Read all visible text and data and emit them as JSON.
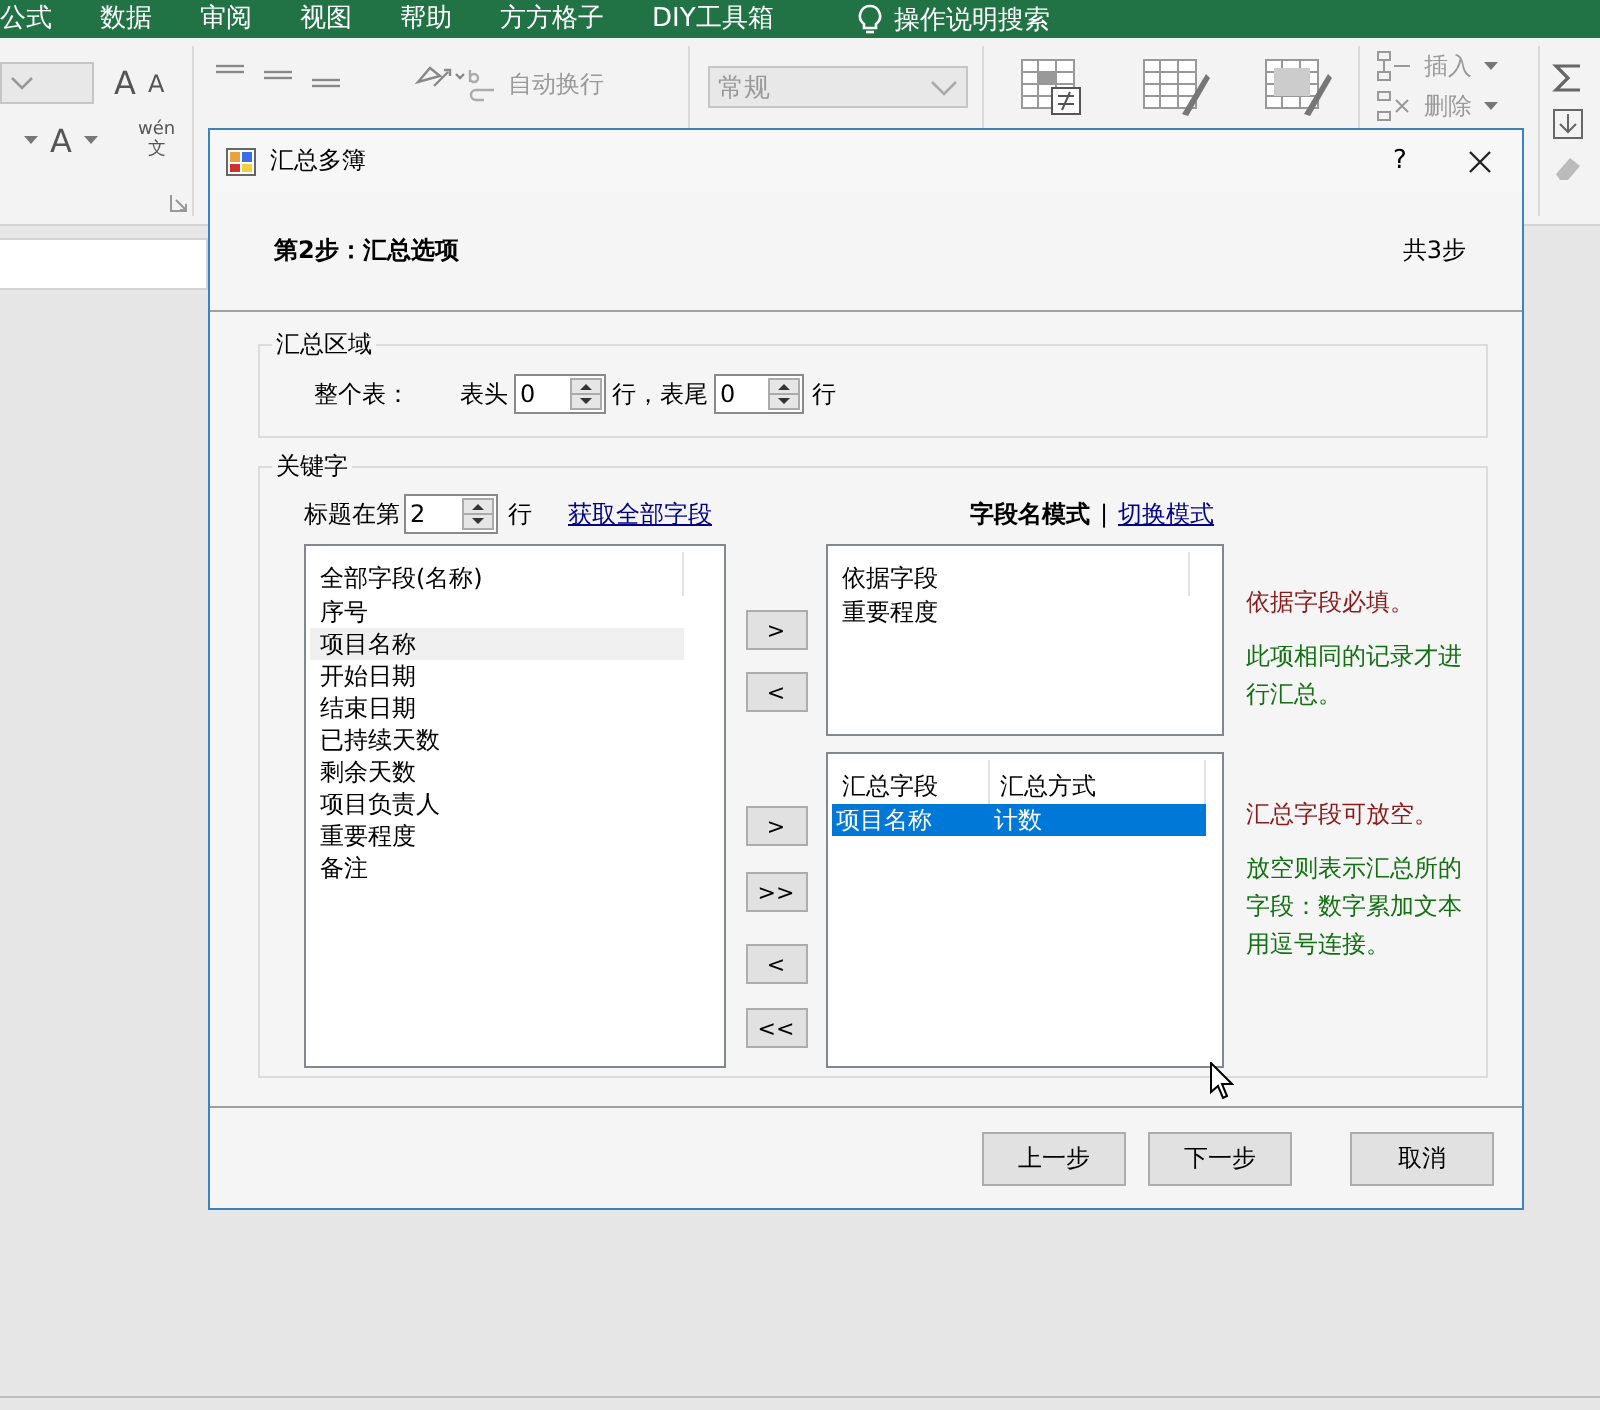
{
  "excel": {
    "tabs": [
      "公式",
      "数据",
      "审阅",
      "视图",
      "帮助",
      "方方格子",
      "DIY工具箱"
    ],
    "tell_me": "操作说明搜索",
    "glyphs": {
      "grow_font": "A",
      "shrink_font": "A",
      "font_color": "A",
      "phonetic_top": "wén",
      "phonetic_bottom": "文"
    },
    "wrap_text": "自动换行",
    "number_format": "常规",
    "insert": "插入",
    "delete": "删除"
  },
  "dialog": {
    "title": "汇总多簿",
    "help": "?",
    "step": "第2步：汇总选项",
    "step_count": "共3步",
    "area_group": {
      "title": "汇总区域",
      "label": "整个表：",
      "header_label": "表头",
      "header_value": "0",
      "middle_label": "行，表尾",
      "footer_value": "0",
      "unit": "行"
    },
    "key_group": {
      "title": "关键字",
      "title_row_label": "标题在第",
      "title_row_value": "2",
      "title_row_unit": "行",
      "fetch_link": "获取全部字段",
      "mode_label": "字段名模式",
      "mode_separator": "|",
      "switch_link": "切换模式",
      "all_fields": {
        "header": "全部字段(名称)",
        "items": [
          {
            "label": "序号",
            "selected": false
          },
          {
            "label": "项目名称",
            "selected": true
          },
          {
            "label": "开始日期",
            "selected": false
          },
          {
            "label": "结束日期",
            "selected": false
          },
          {
            "label": "已持续天数",
            "selected": false
          },
          {
            "label": "剩余天数",
            "selected": false
          },
          {
            "label": "项目负责人",
            "selected": false
          },
          {
            "label": "重要程度",
            "selected": false
          },
          {
            "label": "备注",
            "selected": false
          }
        ]
      },
      "basis_buttons": [
        ">",
        "<"
      ],
      "summary_buttons": [
        ">",
        ">>",
        "<",
        "<<"
      ],
      "basis": {
        "header": "依据字段",
        "items": [
          {
            "label": "重要程度",
            "selected": false
          }
        ]
      },
      "summary": {
        "columns": [
          "汇总字段",
          "汇总方式"
        ],
        "rows": [
          {
            "cells": [
              "项目名称",
              "计数"
            ],
            "selected": true
          }
        ]
      },
      "basis_hints": [
        {
          "text": "依据字段必填。",
          "kind": "warning"
        },
        {
          "text": "此项相同的记录才进行汇总。",
          "kind": "note"
        }
      ],
      "summary_hints": [
        {
          "text": "汇总字段可放空。",
          "kind": "warning"
        },
        {
          "text": "放空则表示汇总所的字段：数字累加文本用逗号连接。",
          "kind": "note"
        }
      ]
    },
    "buttons": [
      "上一步",
      "下一步",
      "取消"
    ]
  }
}
